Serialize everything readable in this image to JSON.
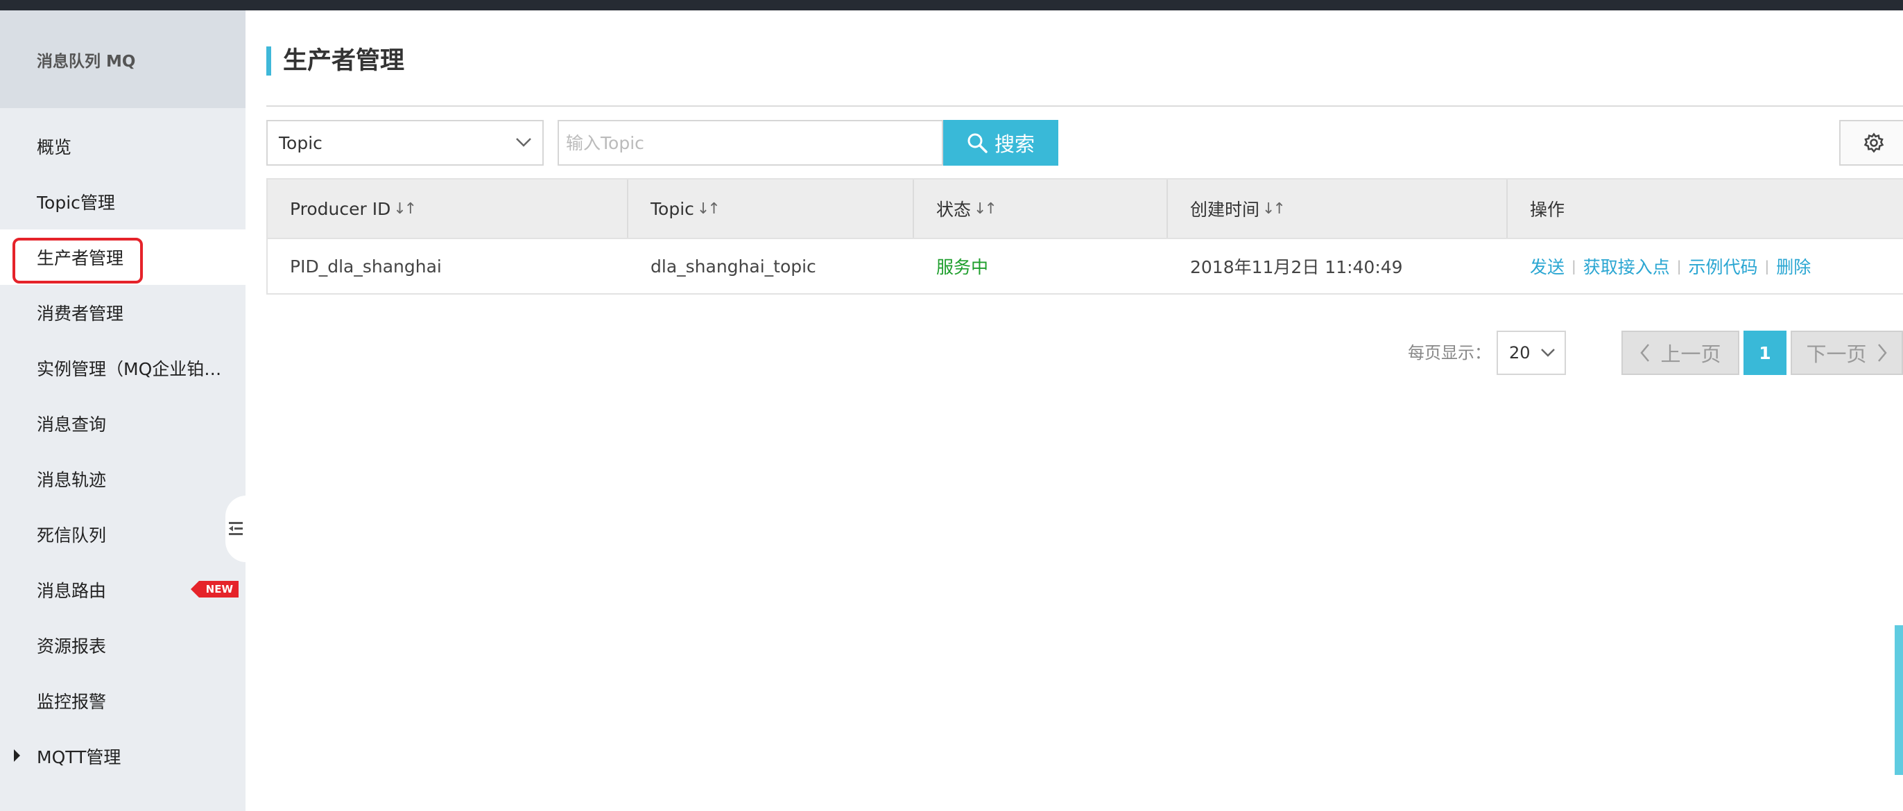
{
  "app": {
    "product_name": "消息队列 MQ"
  },
  "sidebar": {
    "items": [
      {
        "label": "概览"
      },
      {
        "label": "Topic管理"
      },
      {
        "label": "生产者管理"
      },
      {
        "label": "消费者管理"
      },
      {
        "label": "实例管理（MQ企业铂金版）"
      },
      {
        "label": "消息查询"
      },
      {
        "label": "消息轨迹"
      },
      {
        "label": "死信队列"
      },
      {
        "label": "消息路由",
        "badge": "NEW"
      },
      {
        "label": "资源报表"
      },
      {
        "label": "监控报警"
      },
      {
        "label": "MQTT管理"
      }
    ],
    "active_index": 2
  },
  "page": {
    "title": "生产者管理"
  },
  "filter": {
    "field_selected": "Topic",
    "search_placeholder": "输入Topic",
    "search_value": "",
    "search_button_label": "搜索"
  },
  "table": {
    "columns": [
      "Producer ID",
      "Topic",
      "状态",
      "创建时间",
      "操作"
    ],
    "sort_glyph": "↓↑",
    "rows": [
      {
        "producer_id": "PID_dla_shanghai",
        "topic": "dla_shanghai_topic",
        "status": "服务中",
        "created": "2018年11月2日 11:40:49",
        "actions": [
          "发送",
          "获取接入点",
          "示例代码",
          "删除"
        ]
      }
    ]
  },
  "pagination": {
    "page_size_label": "每页显示：",
    "page_size": "20",
    "prev_label": "上一页",
    "next_label": "下一页",
    "current_page": "1"
  },
  "colors": {
    "accent": "#39b9d8",
    "status_running": "#1e9e2c",
    "active_outline": "#e5232a"
  }
}
